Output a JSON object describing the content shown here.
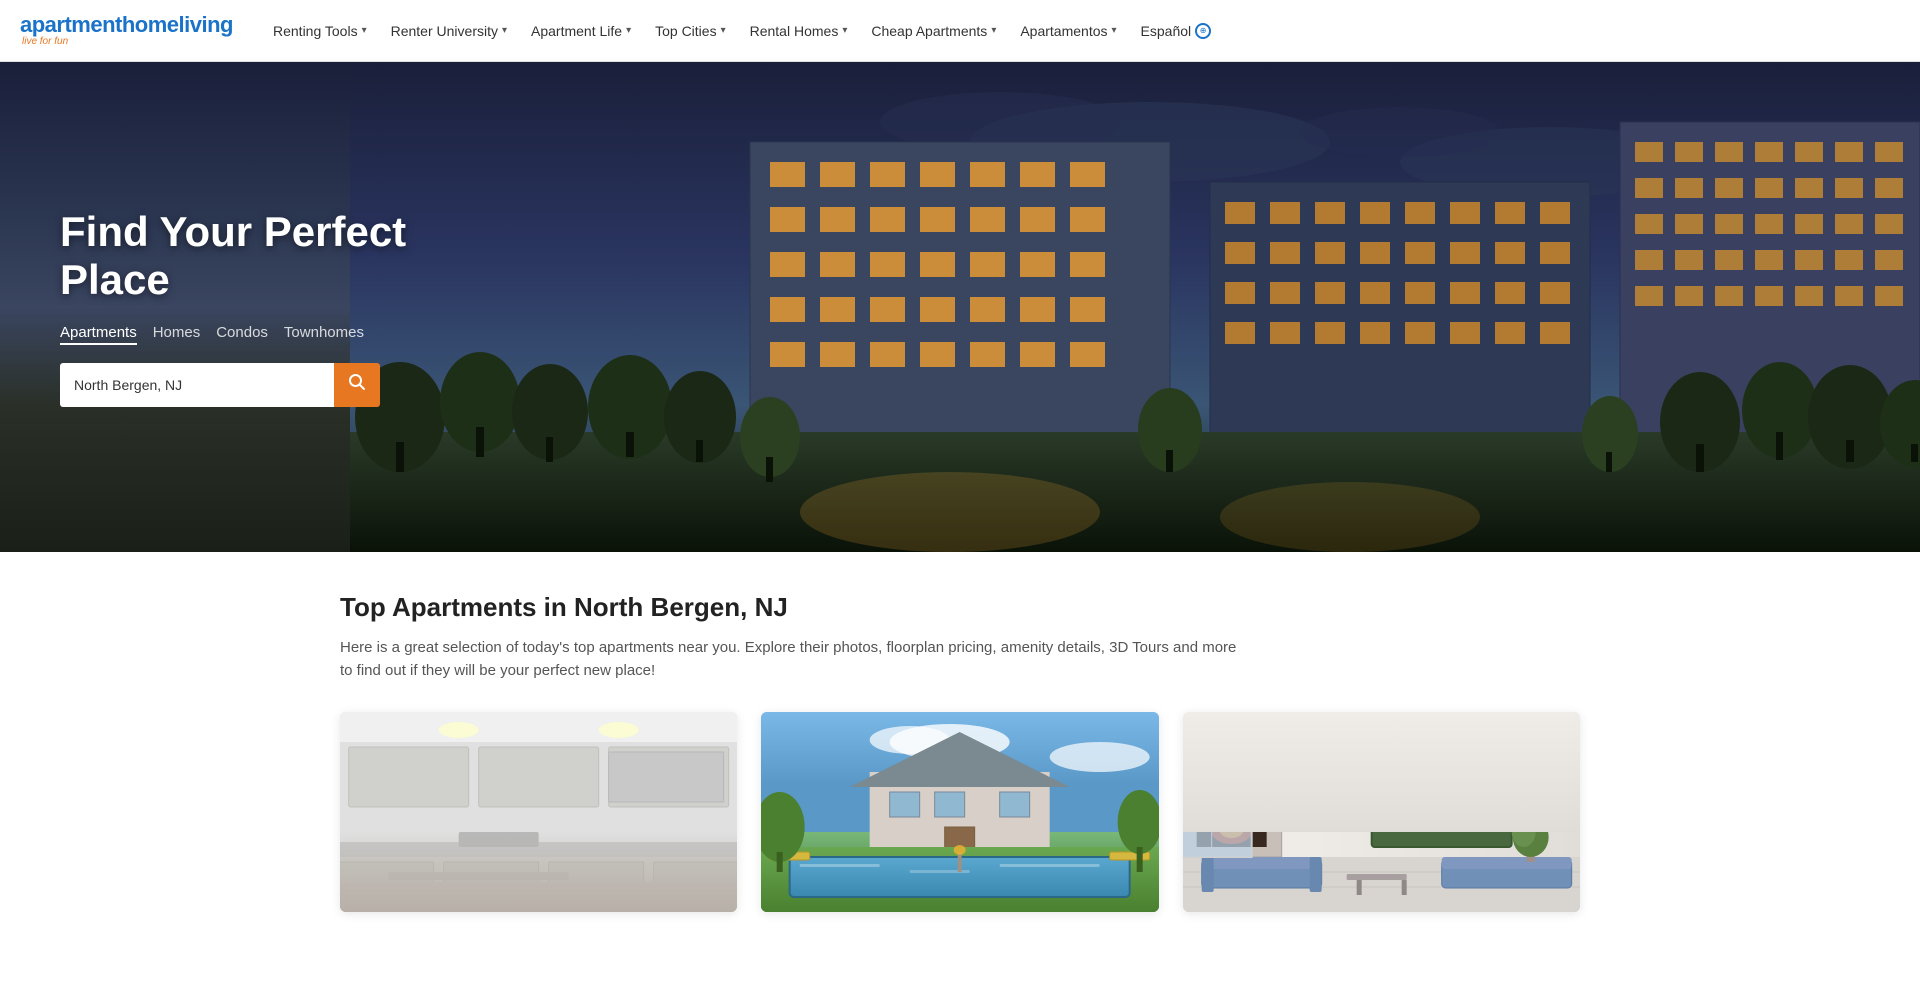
{
  "logo": {
    "text_apt": "apartment",
    "text_home": "home",
    "text_living": "living",
    "tagline": "live for fun"
  },
  "nav": {
    "items": [
      {
        "label": "Renting Tools",
        "has_dropdown": true
      },
      {
        "label": "Renter University",
        "has_dropdown": true
      },
      {
        "label": "Apartment Life",
        "has_dropdown": true
      },
      {
        "label": "Top Cities",
        "has_dropdown": true
      },
      {
        "label": "Rental Homes",
        "has_dropdown": true
      },
      {
        "label": "Cheap Apartments",
        "has_dropdown": true
      },
      {
        "label": "Apartamentos",
        "has_dropdown": true
      },
      {
        "label": "Español",
        "has_dropdown": false,
        "has_globe": true
      }
    ]
  },
  "hero": {
    "title": "Find Your Perfect Place",
    "tabs": [
      {
        "label": "Apartments",
        "active": true
      },
      {
        "label": "Homes",
        "active": false
      },
      {
        "label": "Condos",
        "active": false
      },
      {
        "label": "Townhomes",
        "active": false
      }
    ],
    "search_placeholder": "North Bergen, NJ",
    "search_value": "North Bergen, NJ"
  },
  "main": {
    "section_title": "Top Apartments in North Bergen, NJ",
    "section_desc": "Here is a great selection of today's top apartments near you. Explore their photos, floorplan pricing, amenity details, 3D Tours and more to find out if they will be your perfect new place!",
    "cards": [
      {
        "id": 1,
        "type": "kitchen"
      },
      {
        "id": 2,
        "type": "pool"
      },
      {
        "id": 3,
        "type": "lobby"
      }
    ]
  }
}
